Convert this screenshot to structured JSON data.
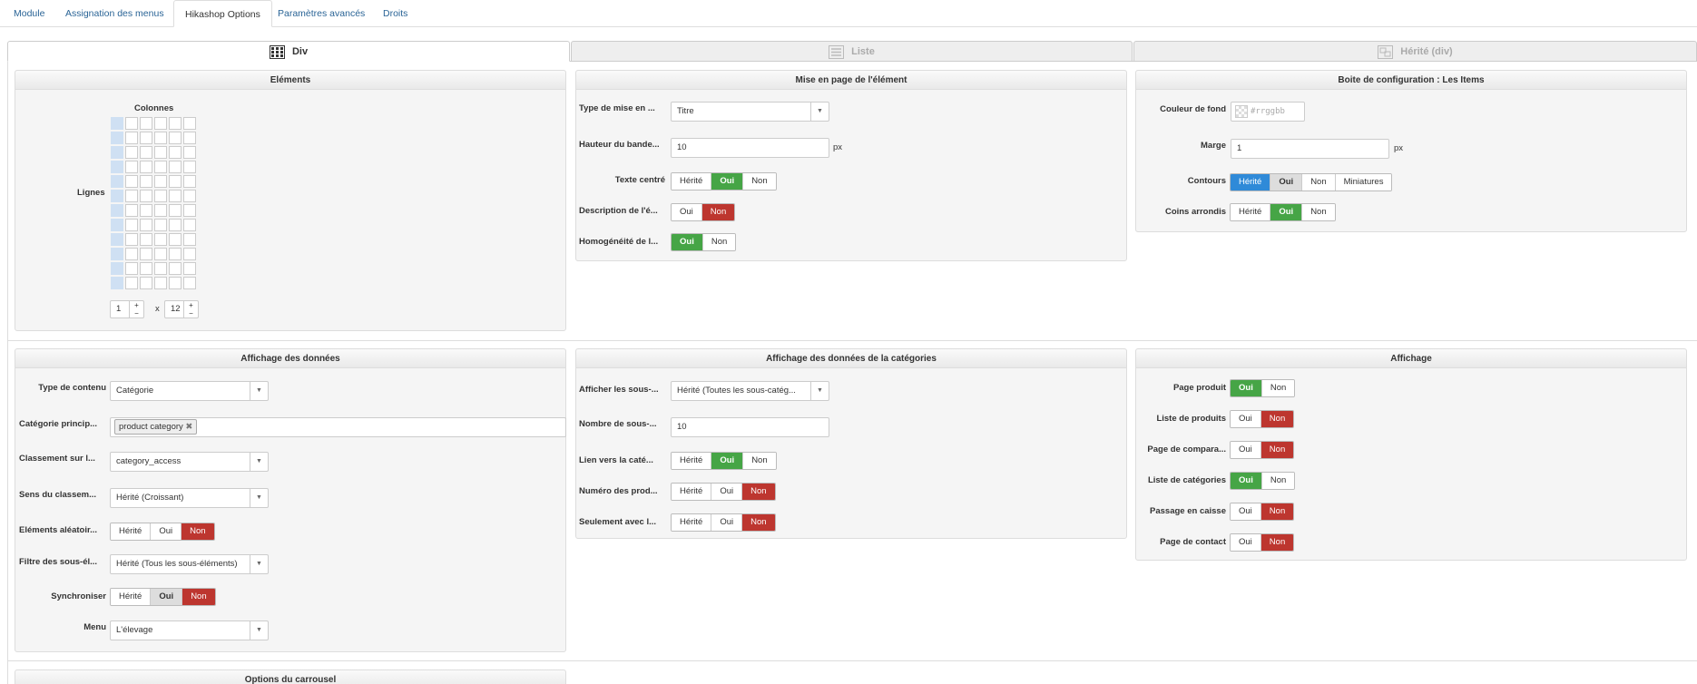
{
  "tabs": [
    "Module",
    "Assignation des menus",
    "Hikashop Options",
    "Paramètres avancés",
    "Droits"
  ],
  "layout_tabs": [
    "Div",
    "Liste",
    "Hérité (div)"
  ],
  "elements": {
    "title": "Eléments",
    "columns_label": "Colonnes",
    "rows_label": "Lignes",
    "columns_value": "1",
    "times": "x",
    "rows_value": "12"
  },
  "mise_en_page": {
    "title": "Mise en page de l'élément",
    "type_label": "Type de mise en ...",
    "type_value": "Titre",
    "hauteur_label": "Hauteur du bande...",
    "hauteur_value": "10",
    "unit": "px",
    "texte_centre_label": "Texte centré",
    "description_label": "Description de l'é...",
    "homogeneite_label": "Homogénéité de l..."
  },
  "boite": {
    "title": "Boite de configuration : Les Items",
    "couleur_label": "Couleur de fond",
    "couleur_placeholder": "#rrggbb",
    "marge_label": "Marge",
    "marge_value": "1",
    "unit": "px",
    "contours_label": "Contours",
    "coins_label": "Coins arrondis"
  },
  "affichage_donnees": {
    "title": "Affichage des données",
    "type_contenu_label": "Type de contenu",
    "type_contenu_value": "Catégorie",
    "categorie_label": "Catégorie princip...",
    "categorie_tag": "product category",
    "classement_label": "Classement sur l...",
    "classement_value": "category_access",
    "sens_label": "Sens du classem...",
    "sens_value": "Hérité (Croissant)",
    "aleatoire_label": "Eléments aléatoir...",
    "filtre_label": "Filtre des sous-él...",
    "filtre_value": "Hérité (Tous les sous-éléments)",
    "synchroniser_label": "Synchroniser",
    "menu_label": "Menu",
    "menu_value": "L'élevage"
  },
  "affichage_categories": {
    "title": "Affichage des données de la catégories",
    "afficher_label": "Afficher les sous-...",
    "afficher_value": "Hérité (Toutes les sous-catég...",
    "nombre_label": "Nombre de sous-...",
    "nombre_value": "10",
    "lien_label": "Lien vers la caté...",
    "numero_label": "Numéro des prod...",
    "seulement_label": "Seulement avec l..."
  },
  "affichage": {
    "title": "Affichage",
    "page_produit": "Page produit",
    "liste_produits": "Liste de produits",
    "page_compara": "Page de compara...",
    "liste_categories": "Liste de catégories",
    "passage_caisse": "Passage en caisse",
    "page_contact": "Page de contact"
  },
  "carrousel_title": "Options du carrousel",
  "btn": {
    "herite": "Hérité",
    "oui": "Oui",
    "non": "Non",
    "miniatures": "Miniatures"
  },
  "colors": {
    "green": "#46a546",
    "red": "#bd362f",
    "blue": "#2f8ad8",
    "link": "#2a6496"
  }
}
